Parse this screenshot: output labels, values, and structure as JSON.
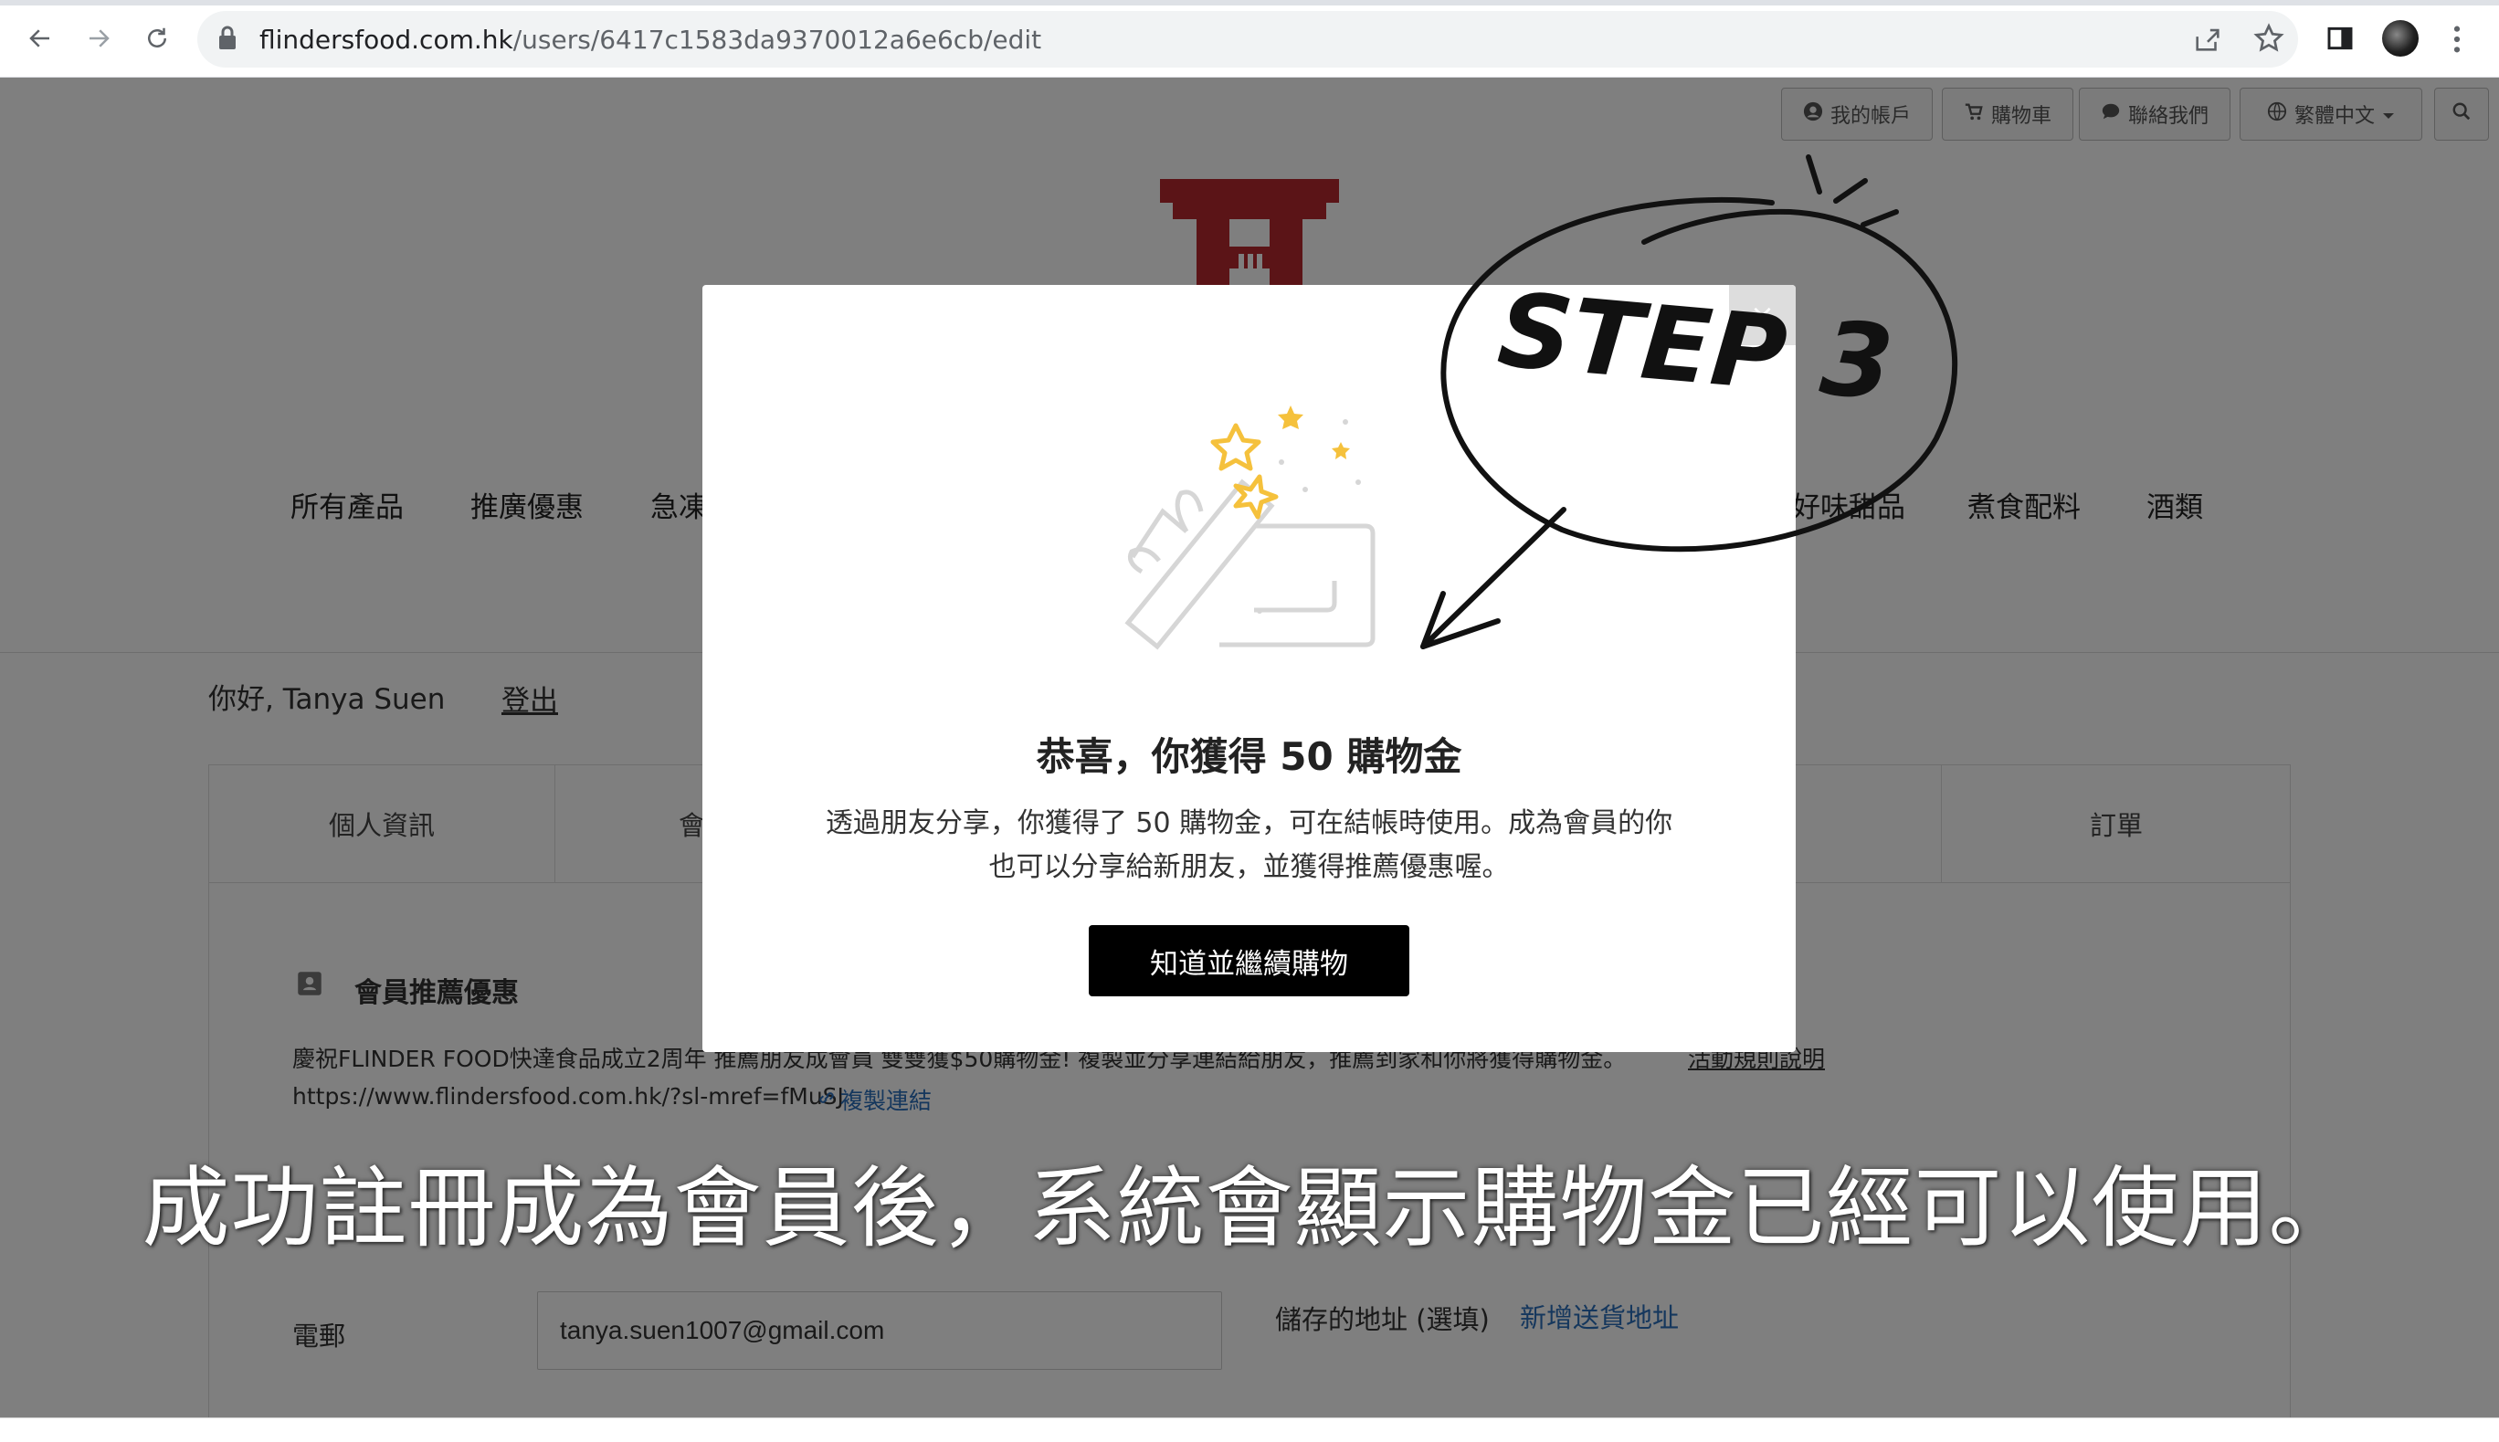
{
  "browser": {
    "url_host": "flindersfood.com.hk",
    "url_path": "/users/6417c1583da9370012a6e6cb/edit"
  },
  "topbar": {
    "account": "我的帳戶",
    "cart": "購物車",
    "contact": "聯絡我們",
    "language": "繁體中文"
  },
  "nav": {
    "items": [
      "所有產品",
      "推廣優惠",
      "急凍",
      "好味甜品",
      "煮食配料",
      "酒類"
    ]
  },
  "user": {
    "greeting": "你好, Tanya Suen",
    "logout": "登出"
  },
  "tabs": {
    "profile": "個人資訊",
    "member": "會",
    "orders": "訂單"
  },
  "referral": {
    "heading": "會員推薦優惠",
    "description": "慶祝FLINDER FOOD快達食品成立2周年 推薦朋友成會員 雙雙獲$50購物金! 複製並分享連結給朋友，推薦到家和你將獲得購物金。",
    "rules_link": "活動規則說明",
    "share_url": "https://www.flindersfood.com.hk/?sl-mref=fMuSJ",
    "copy_link": "複製連結"
  },
  "form": {
    "email_label": "電郵",
    "email_value": "tanya.suen1007@gmail.com",
    "address_label": "儲存的地址 (選填)",
    "add_address": "新增送貨地址"
  },
  "modal": {
    "close": "×",
    "title": "恭喜，你獲得 50 購物金",
    "body": "透過朋友分享，你獲得了 50 購物金，可在結帳時使用。成為會員的你也可以分享給新朋友，並獲得推薦優惠喔。",
    "button": "知道並繼續購物"
  },
  "annotation": {
    "step": "STEP 3",
    "caption": "成功註冊成為會員後，系統會顯示購物金已經可以使用。"
  },
  "colors": {
    "brand_red": "#b7282e",
    "link_blue": "#2a6ebb",
    "star_yellow": "#f5c13c"
  }
}
